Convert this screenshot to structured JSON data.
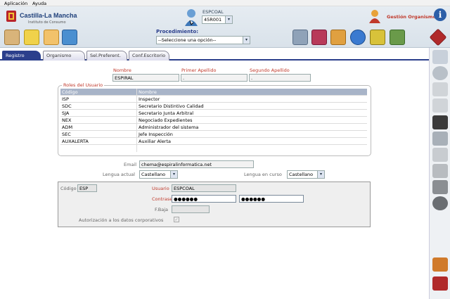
{
  "menubar": {
    "items": [
      "Aplicación",
      "Ayuda"
    ]
  },
  "header": {
    "logo_title": "Castilla-La Mancha",
    "logo_subtitle": "Instituto de Consumo",
    "user_label": "ESPCOAL",
    "user_select_value": "45R001",
    "procedimiento_label": "Procedimiento:",
    "procedimiento_value": "--Seleccione una opción--",
    "app_title": "Gestión Organismo"
  },
  "tabs": [
    "Registro",
    "Organismo",
    "Sel.Preferent.",
    "Conf.Escritorio"
  ],
  "form": {
    "nombre_label": "Nombre",
    "nombre_value": "ESPIRAL",
    "apellido1_label": "Primer Apellido",
    "apellido1_value": ".",
    "apellido2_label": "Segundo Apellido",
    "apellido2_value": ".",
    "roles_legend": "Roles del Usuario",
    "roles_columns": [
      "Código",
      "Nombre"
    ],
    "roles": [
      {
        "code": "ISP",
        "name": "Inspector"
      },
      {
        "code": "SDC",
        "name": "Secretario Distintivo Calidad"
      },
      {
        "code": "SJA",
        "name": "Secretario Junta Arbitral"
      },
      {
        "code": "NEX",
        "name": "Negociado Expedientes"
      },
      {
        "code": "ADM",
        "name": "Administrador del sistema"
      },
      {
        "code": "SEC",
        "name": "Jefe Inspección"
      },
      {
        "code": "AUXALERTA",
        "name": "Auxiliar Alerta"
      }
    ],
    "email_label": "Email",
    "email_value": "chema@espiralinformatica.net",
    "lengua_actual_label": "Lengua actual",
    "lengua_actual_value": "Castellano",
    "lengua_curso_label": "Lengua en curso",
    "lengua_curso_value": "Castellano",
    "codigo_label": "Código",
    "codigo_value": "ESP",
    "usuario_label": "Usuario",
    "usuario_value": "ESPCOAL",
    "contrasena_label": "Contraseña",
    "contrasena_value": "●●●●●●",
    "contrasena_confirm_value": "●●●●●●",
    "fbaja_label": "F.Baja",
    "fbaja_value": "",
    "autorizacion_label": "Autorización a los datos corporativos"
  },
  "colors": {
    "tab_active": "#2b3f8c",
    "label_red": "#c0392b",
    "logo_blue": "#1e3f7a",
    "app_title_red": "#c0392b"
  }
}
